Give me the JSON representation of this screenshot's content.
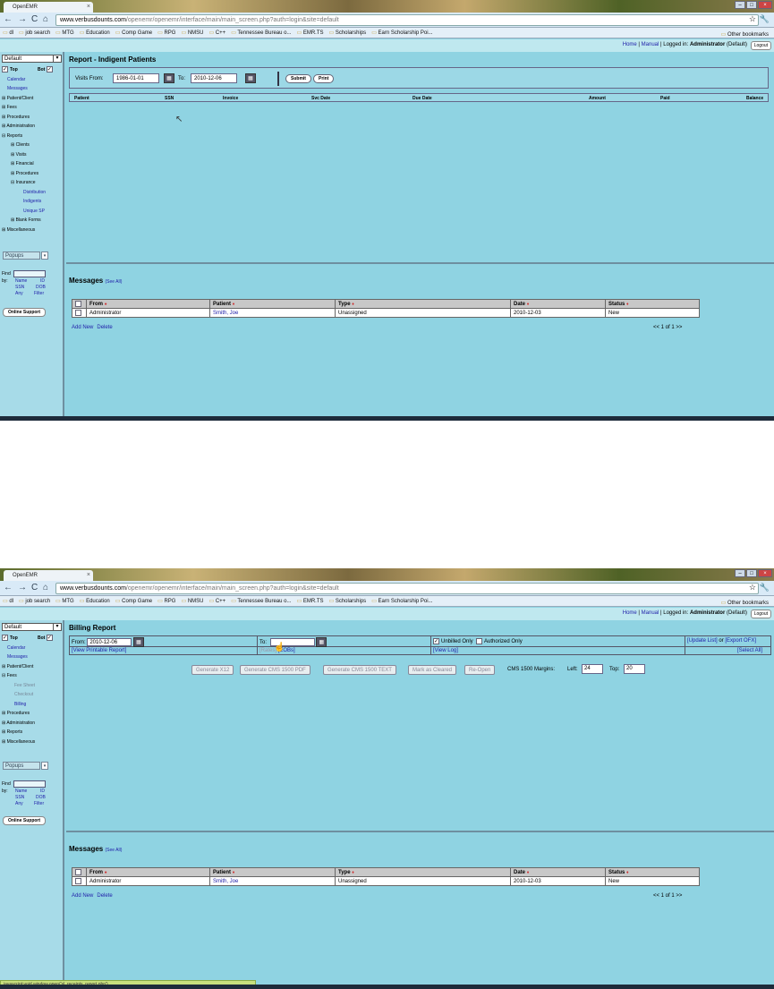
{
  "browser": {
    "tab_title": "OpenEMR",
    "url_host": "www.verbusdounts.com",
    "url_path": "/openemr/openemr/interface/main/main_screen.php?auth=login&site=default",
    "bookmarks": [
      "dl",
      "job search",
      "MTG",
      "Education",
      "Comp Game",
      "RPG",
      "NMSU",
      "C++",
      "Tennessee Bureau o...",
      "EMR.TS",
      "Scholarships",
      "Earn Scholarship Poi..."
    ],
    "other_bookmarks": "Other bookmarks",
    "status_tip": "javascript:void window.open('sl_receipts_report.php')"
  },
  "header": {
    "home": "Home",
    "manual": "Manual",
    "logged_in": "| Logged in:",
    "user": "Administrator",
    "default": "(Default)",
    "logout": "Logout"
  },
  "sidebar": {
    "facility": "Default",
    "top": "Top",
    "bot": "Bot",
    "popups": "Popups",
    "find": "Find",
    "by": "by:",
    "name": "Name",
    "id": "ID",
    "ssn": "SSN",
    "dob": "DOB",
    "any": "Any",
    "filter": "Filter",
    "online_support": "Online Support",
    "tree1": [
      "Calendar",
      "Messages",
      "Patient/Client",
      "Fees",
      "Procedures",
      "Administration",
      "Reports",
      "Clients",
      "Visits",
      "Financial",
      "Procedures",
      "Insurance",
      "Distribution",
      "Indigents",
      "Unique SP",
      "Blank Forms",
      "Miscellaneous"
    ],
    "tree2": [
      "Calendar",
      "Messages",
      "Patient/Client",
      "Fees",
      "Fee Sheet",
      "Checkout",
      "Billing",
      "Procedures",
      "Administration",
      "Reports",
      "Miscellaneous"
    ]
  },
  "report1": {
    "title": "Report - Indigent Patients",
    "visits_from_label": "Visits From:",
    "from_value": "1986-01-01",
    "to_label": "To:",
    "to_value": "2010-12-06",
    "submit": "Submit",
    "print": "Print",
    "columns": [
      "Patient",
      "SSN",
      "Invoice",
      "Svc Date",
      "Due Date",
      "Amount",
      "Paid",
      "Balance"
    ]
  },
  "report2": {
    "title": "Billing Report",
    "from_label": "From:",
    "from_value": "2010-12-06",
    "to_label": "To:",
    "to_value": "",
    "unbilled_only": "Unbilled Only",
    "authorized_only": "Authorized Only",
    "update_list": "[Update List]",
    "or": "or",
    "export_ofx": "[Export OFX]",
    "view_printable": "[View Printable Report]",
    "rates": "[Rates]",
    "eobs": "[EOBs]",
    "view_log": "[View Log]",
    "select_all": "[Select All]",
    "buttons": [
      "Generate X12",
      "Generate CMS 1500 PDF",
      "Generate CMS 1500 TEXT",
      "Mark as Cleared",
      "Re-Open"
    ],
    "margins_label": "CMS 1500 Margins:",
    "left_label": "Left:",
    "left_value": "24",
    "top_label": "Top:",
    "top_value": "20"
  },
  "messages": {
    "title": "Messages",
    "see_all": "(See All)",
    "columns": [
      "From",
      "Patient",
      "Type",
      "Date",
      "Status"
    ],
    "rows": [
      {
        "from": "Administrator",
        "patient": "Smith, Joe",
        "type": "Unassigned",
        "date": "2010-12-03",
        "status": "New"
      }
    ],
    "add_new": "Add New",
    "delete": "Delete",
    "pager": "<<  1 of 1  >>"
  }
}
